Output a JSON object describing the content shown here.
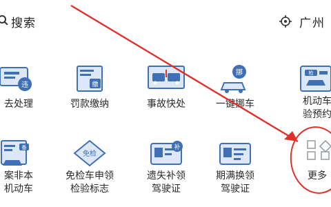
{
  "header": {
    "search_label": "搜索",
    "location_label": "广州"
  },
  "grid": {
    "row1": [
      {
        "label": "去处理",
        "icon": "violation-handling-icon"
      },
      {
        "label": "罚款缴纳",
        "icon": "fine-payment-icon"
      },
      {
        "label": "事故快处",
        "icon": "accident-quick-handling-icon"
      },
      {
        "label": "一键挪车",
        "icon": "move-car-icon"
      },
      {
        "label": "机动车",
        "label2": "验预约",
        "icon": "vehicle-inspection-booking-icon"
      }
    ],
    "row2": [
      {
        "label": "案非本",
        "label2": "机动车",
        "icon": "vehicle-record-icon"
      },
      {
        "label": "免检车申领",
        "label2": "检验标志",
        "icon": "inspection-exempt-icon"
      },
      {
        "label": "遗失补领",
        "label2": "驾驶证",
        "icon": "license-reissue-icon"
      },
      {
        "label": "期满换领",
        "label2": "驾驶证",
        "icon": "license-renewal-icon"
      },
      {
        "label": "更多",
        "icon": "more-apps-icon"
      }
    ]
  },
  "colors": {
    "icon_blue": "#3f6fb5",
    "icon_light": "#dce8f7",
    "arrow_red": "#e0302a"
  }
}
